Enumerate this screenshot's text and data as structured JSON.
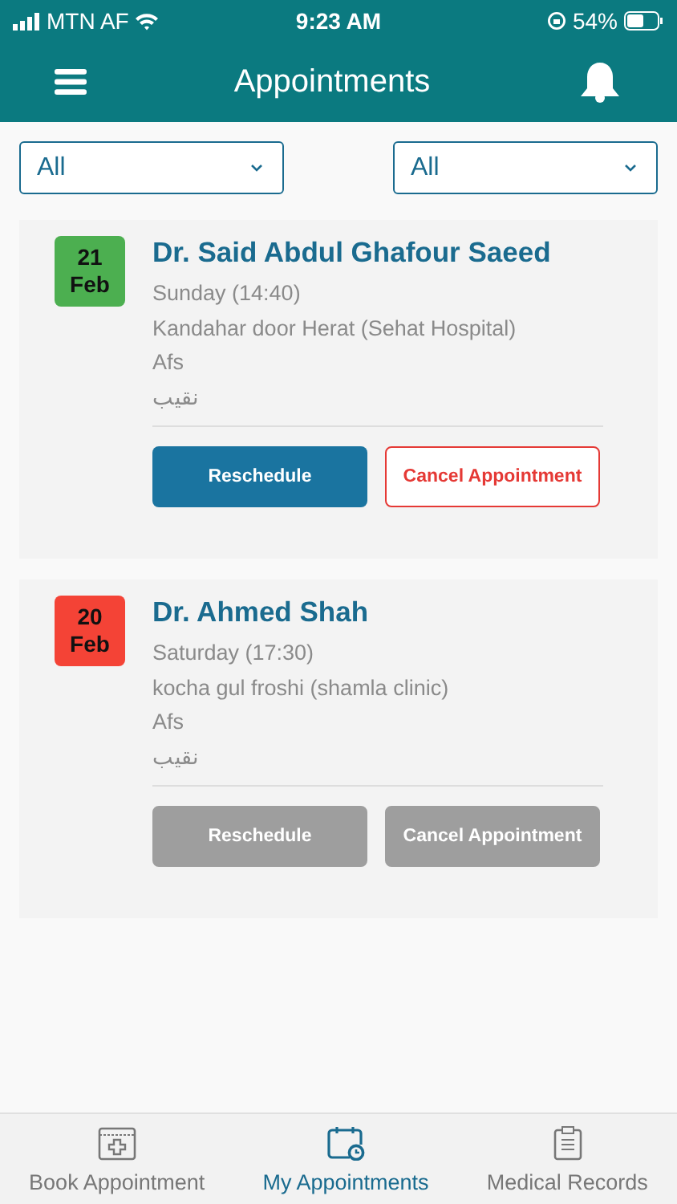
{
  "status_bar": {
    "carrier": "MTN AF",
    "time": "9:23 AM",
    "battery": "54%"
  },
  "header": {
    "title": "Appointments"
  },
  "filters": [
    {
      "value": "All"
    },
    {
      "value": "All"
    }
  ],
  "appointments": [
    {
      "day": "21",
      "month": "Feb",
      "color": "#4caf50",
      "doctor": "Dr. Said Abdul Ghafour Saeed",
      "when": "Sunday (14:40)",
      "place": "Kandahar door Herat (Sehat Hospital)",
      "line_3": "Afs",
      "line_4": "نقيب",
      "disabled": false,
      "reschedule": "Reschedule",
      "cancel": "Cancel Appointment"
    },
    {
      "day": "20",
      "month": "Feb",
      "color": "#f44336",
      "doctor": "Dr. Ahmed Shah",
      "when": "Saturday (17:30)",
      "place": "kocha gul froshi (shamla clinic)",
      "line_3": "Afs",
      "line_4": "نقيب",
      "disabled": true,
      "reschedule": "Reschedule",
      "cancel": "Cancel Appointment"
    }
  ],
  "tabs": [
    {
      "label": "Book Appointment",
      "kind": "book",
      "selected": false
    },
    {
      "label": "My Appointments",
      "kind": "mine",
      "selected": true
    },
    {
      "label": "Medical Records",
      "kind": "records",
      "selected": false
    }
  ]
}
